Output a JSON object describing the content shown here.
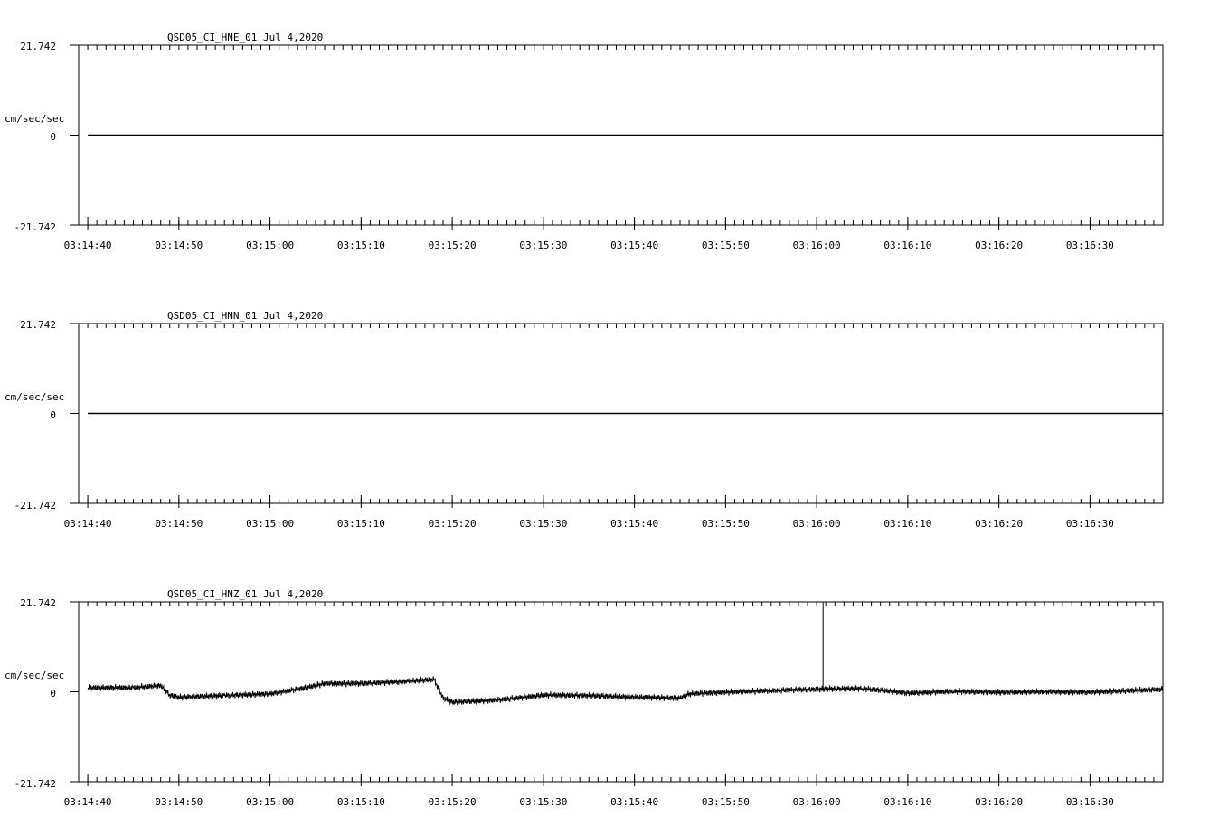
{
  "chart_data": [
    {
      "type": "line",
      "title": "QSD05_CI_HNE_01  Jul 4,2020",
      "ylabel": "cm/sec/sec",
      "ytick_labels": [
        "21.742",
        "0",
        "-21.742"
      ],
      "ylim": [
        -21.742,
        21.742
      ],
      "xtick_labels": [
        "03:14:40",
        "03:14:50",
        "03:15:00",
        "03:15:10",
        "03:15:20",
        "03:15:30",
        "03:15:40",
        "03:15:50",
        "03:16:00",
        "03:16:10",
        "03:16:20",
        "03:16:30"
      ],
      "xlim": [
        "03:14:39",
        "03:16:38"
      ],
      "series": [
        {
          "x": [
            "03:14:40",
            "03:16:38"
          ],
          "values": [
            0,
            0
          ]
        }
      ]
    },
    {
      "type": "line",
      "title": "QSD05_CI_HNN_01  Jul 4,2020",
      "ylabel": "cm/sec/sec",
      "ytick_labels": [
        "21.742",
        "0",
        "-21.742"
      ],
      "ylim": [
        -21.742,
        21.742
      ],
      "xtick_labels": [
        "03:14:40",
        "03:14:50",
        "03:15:00",
        "03:15:10",
        "03:15:20",
        "03:15:30",
        "03:15:40",
        "03:15:50",
        "03:16:00",
        "03:16:10",
        "03:16:20",
        "03:16:30"
      ],
      "xlim": [
        "03:14:39",
        "03:16:38"
      ],
      "series": [
        {
          "x": [
            "03:14:40",
            "03:16:38"
          ],
          "values": [
            0,
            0
          ]
        }
      ]
    },
    {
      "type": "line",
      "title": "QSD05_CI_HNZ_01  Jul 4,2020",
      "ylabel": "cm/sec/sec",
      "ytick_labels": [
        "21.742",
        "0",
        "-21.742"
      ],
      "ylim": [
        -21.742,
        21.742
      ],
      "xtick_labels": [
        "03:14:40",
        "03:14:50",
        "03:15:00",
        "03:15:10",
        "03:15:20",
        "03:15:30",
        "03:15:40",
        "03:15:50",
        "03:16:00",
        "03:16:10",
        "03:16:20",
        "03:16:30"
      ],
      "xlim": [
        "03:14:39",
        "03:16:38"
      ],
      "series": [
        {
          "x": [
            "03:14:40",
            "03:14:45",
            "03:14:48",
            "03:14:49",
            "03:14:50",
            "03:14:55",
            "03:15:00",
            "03:15:04",
            "03:15:06",
            "03:15:10",
            "03:15:15",
            "03:15:18",
            "03:15:19",
            "03:15:20",
            "03:15:25",
            "03:15:30",
            "03:15:35",
            "03:15:40",
            "03:15:45",
            "03:15:46",
            "03:15:50",
            "03:15:55",
            "03:16:00",
            "03:16:01",
            "03:16:05",
            "03:16:10",
            "03:16:15",
            "03:16:20",
            "03:16:25",
            "03:16:30",
            "03:16:38"
          ],
          "values": [
            1.0,
            1.0,
            1.5,
            -0.8,
            -1.3,
            -0.9,
            -0.5,
            1.0,
            2.0,
            2.0,
            2.5,
            3.0,
            -1.5,
            -2.5,
            -2.0,
            -0.8,
            -0.9,
            -1.3,
            -1.5,
            -0.5,
            -0.1,
            0.3,
            0.6,
            0.7,
            0.8,
            -0.3,
            0.1,
            -0.1,
            0.0,
            -0.1,
            0.6
          ]
        }
      ],
      "annotations": [
        {
          "type": "spike",
          "x": "03:16:00.7",
          "value": 21.742
        }
      ]
    }
  ]
}
